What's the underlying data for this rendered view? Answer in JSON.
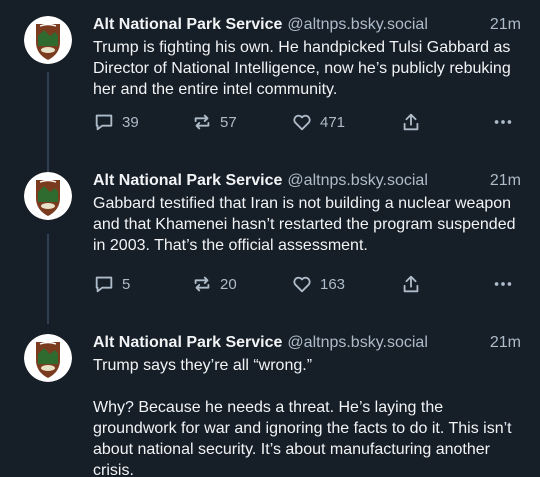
{
  "posts": [
    {
      "display_name": "Alt National Park Service",
      "handle": "@altnps.bsky.social",
      "time": "21m",
      "text": "Trump is fighting his own. He handpicked Tulsi Gabbard as Director of National Intelligence, now he’s publicly rebuking her and the entire intel community.",
      "replies": "39",
      "reposts": "57",
      "likes": "471"
    },
    {
      "display_name": "Alt National Park Service",
      "handle": "@altnps.bsky.social",
      "time": "21m",
      "text": "Gabbard testified that Iran is not building a nuclear weapon and that Khamenei hasn’t restarted the program suspended in 2003. That’s the official assessment.",
      "replies": "5",
      "reposts": "20",
      "likes": "163"
    },
    {
      "display_name": "Alt National Park Service",
      "handle": "@altnps.bsky.social",
      "time": "21m",
      "text": "Trump says they’re all “wrong.”\n\nWhy? Because he needs a threat. He’s laying the groundwork for war and ignoring the facts to do it. This isn’t about national security. It’s about manufacturing another crisis."
    }
  ],
  "colors": {
    "background": "#161e27",
    "text": "#f1f3f5",
    "muted": "#aebbc9",
    "thread_line": "#2e4052",
    "avatar_brown": "#7a3b1f",
    "avatar_green": "#2f6b2f"
  },
  "icons": [
    "reply-icon",
    "repost-icon",
    "like-icon",
    "share-icon",
    "more-icon"
  ]
}
